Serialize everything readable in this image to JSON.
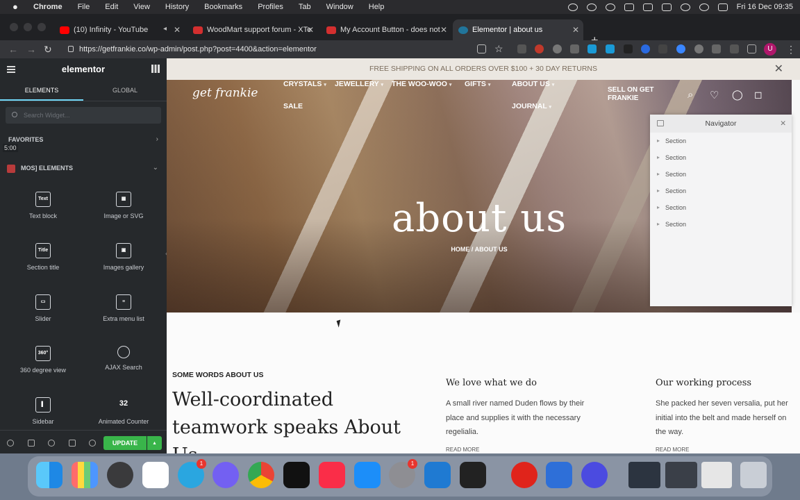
{
  "menubar": {
    "app": "Chrome",
    "items": [
      "File",
      "Edit",
      "View",
      "History",
      "Bookmarks",
      "Profiles",
      "Tab",
      "Window",
      "Help"
    ],
    "clock": "Fri 16 Dec  09:35"
  },
  "tabs": [
    {
      "title": "(10) Infinity - YouTube",
      "color": "#ff0000"
    },
    {
      "title": "WoodMart support forum - XTe",
      "color": "#d32f2f"
    },
    {
      "title": "My Account Button - does not",
      "color": "#d32f2f"
    },
    {
      "title": "Elementor | about us",
      "color": "#21759b"
    }
  ],
  "address": {
    "url": "https://getfrankie.co/wp-admin/post.php?post=4400&action=elementor",
    "avatar_letter": "U"
  },
  "panel": {
    "logo": "elementor",
    "tabs": [
      "ELEMENTS",
      "GLOBAL"
    ],
    "search_placeholder": "Search Widget...",
    "favorites": "FAVORITES",
    "time_badge": "5:00",
    "section": "MOS] ELEMENTS",
    "widgets": [
      {
        "label": "Text block",
        "icon": "Text"
      },
      {
        "label": "Image or SVG",
        "icon": ""
      },
      {
        "label": "Section title",
        "icon": "Title"
      },
      {
        "label": "Images gallery",
        "icon": ""
      },
      {
        "label": "Slider",
        "icon": ""
      },
      {
        "label": "Extra menu list",
        "icon": ""
      },
      {
        "label": "360 degree view",
        "icon": "360°"
      },
      {
        "label": "AJAX Search",
        "icon": ""
      },
      {
        "label": "Sidebar",
        "icon": ""
      },
      {
        "label": "Animated Counter",
        "icon": "32"
      }
    ],
    "update": "UPDATE"
  },
  "site": {
    "topbar": "FREE SHIPPING ON ALL ORDERS OVER $100 + 30 DAY RETURNS",
    "logo": "get frankie",
    "nav": [
      "CRYSTALS",
      "JEWELLERY",
      "THE WOO-WOO",
      "GIFTS",
      "ABOUT US",
      "SALE",
      "JOURNAL"
    ],
    "sell": "SELL ON GET FRANKIE",
    "hero_title": "about us",
    "breadcrumb": "HOME  /  ABOUT US",
    "eyebrow": "SOME WORDS ABOUT US",
    "heading": "Well-coordinated teamwork speaks About Us",
    "col1_title": "We love what we do",
    "col1_text": "A small river named Duden flows by their place and supplies it with the necessary regelialia.",
    "col2_title": "Our working process",
    "col2_text": "She packed her seven versalia, put her initial into the belt and made herself on the way.",
    "read_more": "READ MORE"
  },
  "navigator": {
    "title": "Navigator",
    "rows": [
      "Section",
      "Section",
      "Section",
      "Section",
      "Section",
      "Section"
    ]
  },
  "dock_badges": [
    "1",
    "1"
  ]
}
